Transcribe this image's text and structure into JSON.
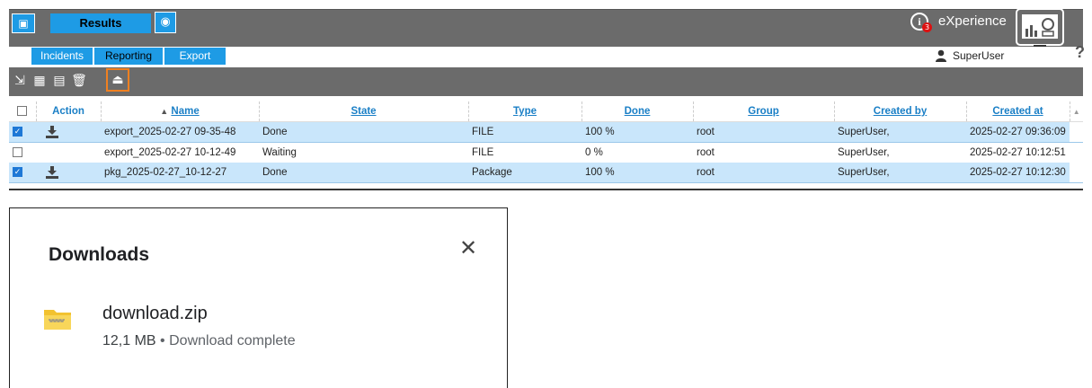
{
  "header": {
    "results_tab": "Results",
    "brand": "eXperience",
    "info_badge": "3"
  },
  "subnav": {
    "tabs": [
      "Incidents",
      "Reporting",
      "Export"
    ],
    "user": "SuperUser",
    "help": "?"
  },
  "toolbar": {
    "icons": [
      "export-file-icon",
      "export-package-icon",
      "import-package-icon",
      "delete-icon",
      "download-icon"
    ],
    "highlighted": "download-icon"
  },
  "table": {
    "columns": [
      "Action",
      "Name",
      "State",
      "Type",
      "Done",
      "Group",
      "Created by",
      "Created at"
    ],
    "sort_indicator": "▲",
    "rows": [
      {
        "checked": true,
        "download": true,
        "name": "export_2025-02-27 09-35-48",
        "state": "Done",
        "type": "FILE",
        "done": "100 %",
        "group": "root",
        "created_by": "SuperUser,",
        "created_at": "2025-02-27 09:36:09"
      },
      {
        "checked": false,
        "download": false,
        "name": "export_2025-02-27 10-12-49",
        "state": "Waiting",
        "type": "FILE",
        "done": "0 %",
        "group": "root",
        "created_by": "SuperUser,",
        "created_at": "2025-02-27 10:12:51"
      },
      {
        "checked": true,
        "download": true,
        "name": "pkg_2025-02-27_10-12-27",
        "state": "Done",
        "type": "Package",
        "done": "100 %",
        "group": "root",
        "created_by": "SuperUser,",
        "created_at": "2025-02-27 10:12:30"
      }
    ]
  },
  "downloads": {
    "title": "Downloads",
    "close": "✕",
    "file_name": "download.zip",
    "file_size": "12,1 MB",
    "separator": "•",
    "status": "Download complete"
  },
  "colors": {
    "accent": "#1e9be5",
    "bar": "#6b6b6b",
    "selected_row": "#c9e6fb",
    "highlight": "#f08020"
  }
}
